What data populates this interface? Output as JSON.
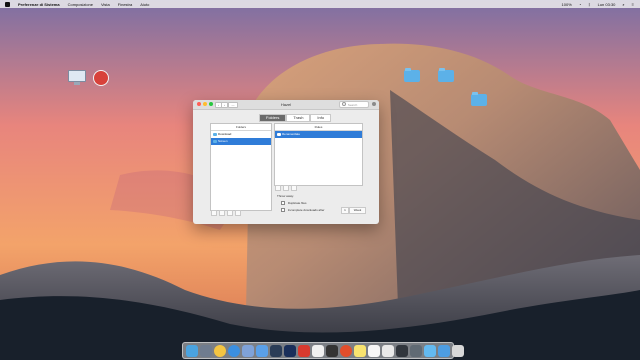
{
  "menubar": {
    "app": "Preferenze di Sistema",
    "items": [
      "Composizione",
      "Vista",
      "Finestra",
      "Aiuto"
    ],
    "status": {
      "battery": "100%",
      "clock": "Lun 03:30"
    }
  },
  "desktop_items": [
    {
      "kind": "computer"
    },
    {
      "kind": "red-disk"
    },
    {
      "kind": "folder"
    },
    {
      "kind": "folder"
    },
    {
      "kind": "folder"
    }
  ],
  "window": {
    "title": "Hazel",
    "search_placeholder": "Search",
    "tabs": [
      "Folders",
      "Trash",
      "Info"
    ],
    "folders_panel": {
      "header": "Folders",
      "items": [
        "Download",
        "Screen"
      ]
    },
    "rules_panel": {
      "header": "Rules",
      "items": [
        "Rename/date"
      ]
    },
    "throw_away_label": "Throw away:",
    "duplicate_label": "Duplicate files",
    "incomplete_label": "Incomplete downloads after",
    "incomplete_value": "1",
    "incomplete_unit": "Week"
  },
  "colors": {
    "window_bg": "#ececec",
    "selection": "#2f7cd8",
    "folder": "#5cb1e8"
  },
  "dock_items": [
    "finder-icon",
    "launchpad-icon",
    "chrome-icon",
    "safari-icon",
    "photo-icon",
    "app-store-icon",
    "lightroom-icon",
    "photoshop-icon",
    "pdf-icon",
    "skype-icon",
    "utility-icon",
    "music-icon",
    "notes-icon",
    "files-icon",
    "calendar-icon",
    "video-icon",
    "settings-icon",
    "folder-icon",
    "downloads-icon",
    "trash-icon"
  ]
}
